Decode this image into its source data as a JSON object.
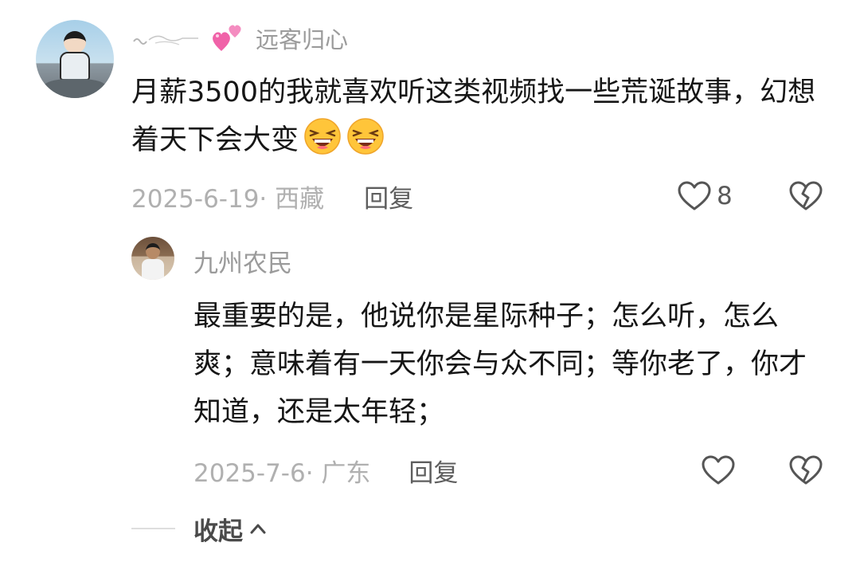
{
  "comment": {
    "author": "远客归心",
    "text": "月薪3500的我就喜欢听这类视频找一些荒诞故事，幻想着天下会大变",
    "date": "2025-6-19· 西藏",
    "reply_label": "回复",
    "likes": "8",
    "emojis": [
      "laughing-emoji",
      "laughing-emoji"
    ],
    "deco_icon": "pink-hearts-icon"
  },
  "reply": {
    "author": "九州农民",
    "text": "最重要的是，他说你是星际种子；怎么听，怎么爽；意味着有一天你会与众不同；等你老了，你才知道，还是太年轻；",
    "date": "2025-7-6· 广东",
    "reply_label": "回复"
  },
  "collapse": {
    "label": "收起"
  },
  "colors": {
    "text": "#161616",
    "muted": "#9b9b9b",
    "date": "#b0b0b0",
    "icon": "#5a5a5a",
    "heart_pink": "#f062a8"
  }
}
